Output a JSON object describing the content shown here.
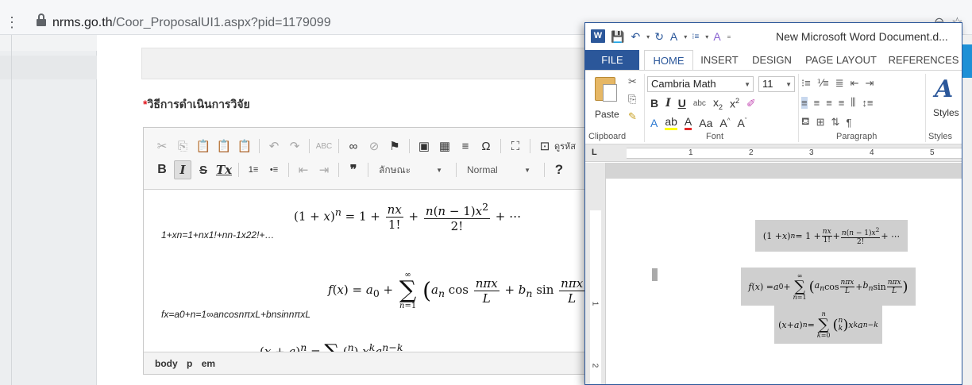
{
  "browser": {
    "url_host": "nrms.go.th",
    "url_path": "/Coor_ProposalUI1.aspx?pid=1179099"
  },
  "page": {
    "section_required_mark": "*",
    "section_heading": "วิธีการดำเนินการวิจัย"
  },
  "editor": {
    "toolbar_row1": [
      "✂",
      "⎘",
      "📋",
      "📋",
      "📋",
      "↶",
      "↷",
      "ABC",
      "∞",
      "⊘",
      "⚑",
      "▣",
      "▦",
      "≡",
      "Ω",
      "⛶",
      "⊡"
    ],
    "source_label": "ดูรหัส",
    "toolbar_row2": {
      "bold": "B",
      "italic": "I",
      "strike": "S",
      "remove_format": "Tx",
      "numbered_list": "1≡",
      "bullet_list": "•≡",
      "outdent": "⇤",
      "indent": "⇥",
      "blockquote": "❞",
      "styles_combo": "ลักษณะ",
      "format_combo": "Normal",
      "help": "?"
    },
    "content": {
      "linear_1": "1+xn=1+nx1!+nn-1x22!+…",
      "linear_2": "fx=a0+n=1∞ancosnπxL+bnsinnπxL"
    },
    "status_path": [
      "body",
      "p",
      "em"
    ]
  },
  "word": {
    "doc_title": "New Microsoft Word Document.d...",
    "tabs": [
      "FILE",
      "HOME",
      "INSERT",
      "DESIGN",
      "PAGE LAYOUT",
      "REFERENCES"
    ],
    "active_tab": "HOME",
    "font_name": "Cambria Math",
    "font_size": "11",
    "paste_label": "Paste",
    "styles_label": "Styles",
    "group_labels": [
      "Clipboard",
      "Font",
      "Paragraph",
      "Styles"
    ],
    "ruler_marks": [
      "1",
      "2",
      "3",
      "4",
      "5"
    ],
    "vruler_marks": [
      "1",
      "2"
    ],
    "ruler_corner": "L"
  },
  "colors": {
    "word_blue": "#2b579a",
    "required_red": "#e2161e",
    "equation_shade": "#cfcfcf"
  }
}
